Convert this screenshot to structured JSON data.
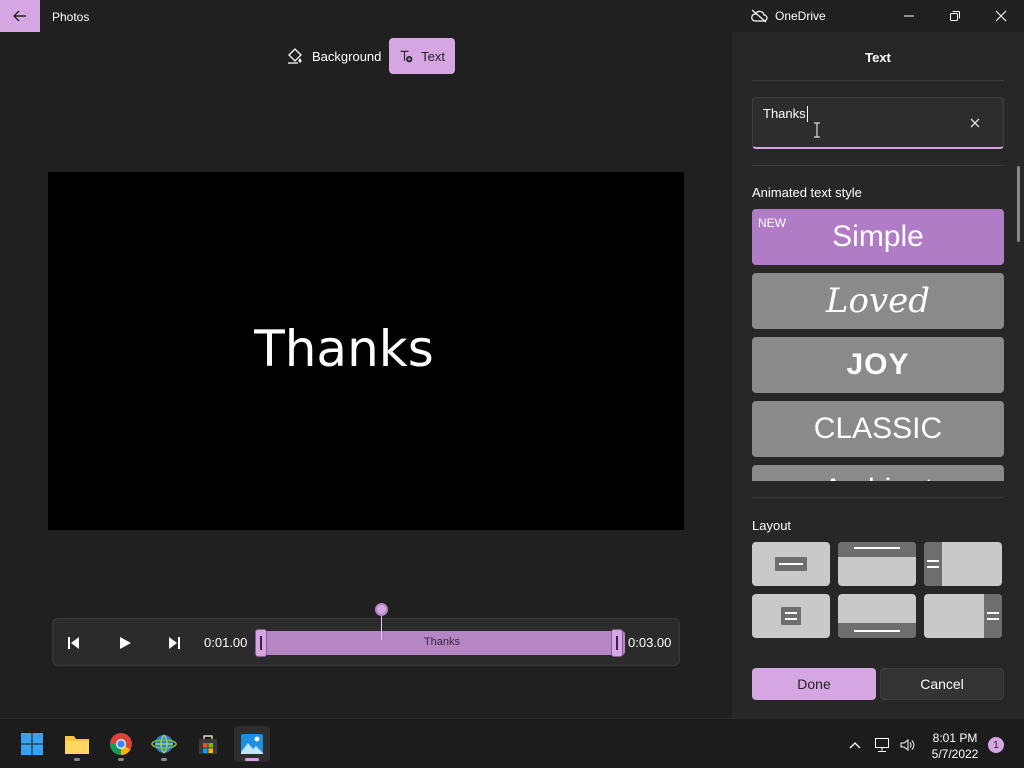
{
  "window": {
    "title": "Photos",
    "onedrive_label": "OneDrive"
  },
  "toolbar": {
    "background_label": "Background",
    "text_label": "Text"
  },
  "preview": {
    "text": "Thanks"
  },
  "timeline": {
    "start_time": "0:01.00",
    "end_time": "0:03.00",
    "clip_label": "Thanks"
  },
  "panel": {
    "title": "Text",
    "text_input_value": "Thanks",
    "animated_style_label": "Animated text style",
    "styles": [
      {
        "label": "Simple",
        "badge": "NEW",
        "selected": true
      },
      {
        "label": "Loved"
      },
      {
        "label": "JOY"
      },
      {
        "label": "CLASSIC"
      },
      {
        "label": "Ambient"
      }
    ],
    "layout_label": "Layout",
    "done_label": "Done",
    "cancel_label": "Cancel"
  },
  "taskbar": {
    "apps": [
      "windows-start",
      "file-explorer",
      "chrome",
      "network-app",
      "microsoft-store",
      "photos"
    ],
    "time": "8:01 PM",
    "date": "5/7/2022",
    "notification_count": "1"
  },
  "colors": {
    "accent": "#d6a6e3",
    "selected_style": "#b07cc6",
    "background": "#202020",
    "panel": "#272727"
  }
}
